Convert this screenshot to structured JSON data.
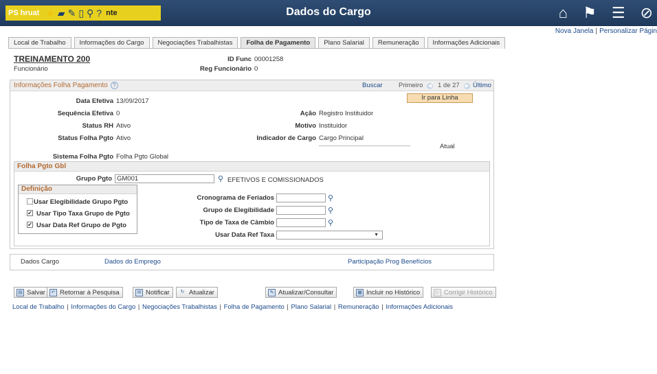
{
  "banner": {
    "ps_label": "PS hruat",
    "nte_label": "nte",
    "title": "Dados do Cargo",
    "left_icons": [
      "star-icon",
      "folder-icon",
      "pencil-icon",
      "document-icon",
      "search-icon",
      "help-icon"
    ],
    "right_icons": [
      "home-icon",
      "flag-icon",
      "menu-icon",
      "compass-icon"
    ]
  },
  "toplinks": {
    "new_window": "Nova Janela",
    "personalize": "Personalizar Págin"
  },
  "tabs": [
    {
      "label": "Local de Trabalho",
      "active": false
    },
    {
      "label": "Informações do Cargo",
      "active": false
    },
    {
      "label": "Negociações Trabalhistas",
      "active": false
    },
    {
      "label": "Folha de Pagamento",
      "active": true
    },
    {
      "label": "Plano Salarial",
      "active": false
    },
    {
      "label": "Remuneração",
      "active": false
    },
    {
      "label": "Informações Adicionais",
      "active": false
    }
  ],
  "employee": {
    "name": "TREINAMENTO 200",
    "type": "Funcionário",
    "id_func_label": "ID Func",
    "id_func_value": "00001258",
    "reg_label": "Reg Funcionário",
    "reg_value": "0"
  },
  "section": {
    "title": "Informações Folha Pagamento",
    "buscar": "Buscar",
    "primeiro": "Primeiro",
    "counter": "1 de 27",
    "ultimo": "Último",
    "goto_button": "Ir para Linha"
  },
  "fields": {
    "data_efetiva": {
      "label": "Data Efetiva",
      "value": "13/09/2017"
    },
    "sequencia": {
      "label": "Sequência Efetiva",
      "value": "0"
    },
    "status_rh": {
      "label": "Status RH",
      "value": "Ativo"
    },
    "status_folha": {
      "label": "Status Folha Pgto",
      "value": "Ativo"
    },
    "acao": {
      "label": "Ação",
      "value": "Registro Instituidor"
    },
    "motivo": {
      "label": "Motivo",
      "value": "Instituidor"
    },
    "indicador": {
      "label": "Indicador de Cargo",
      "value": "Cargo Principal"
    },
    "atual": "Atual",
    "sistema": {
      "label": "Sistema Folha Pgto",
      "value": "Folha Pgto Global"
    }
  },
  "gbl": {
    "title": "Folha Pgto Gbl",
    "grupo_label": "Grupo Pgto",
    "grupo_value": "GM001",
    "grupo_desc": "EFETIVOS E COMISSIONADOS",
    "definicao_title": "Definição",
    "checks": [
      {
        "label": "Usar Elegibilidade Grupo Pgto",
        "checked": false
      },
      {
        "label": "Usar Tipo Taxa Grupo de Pgto",
        "checked": true
      },
      {
        "label": "Usar Data Ref Grupo de Pgto",
        "checked": true
      }
    ],
    "cronograma_label": "Cronograma de Feriados",
    "grupo_eleg_label": "Grupo de Elegibilidade",
    "tipo_taxa_label": "Tipo de Taxa de Câmbio",
    "data_ref_label": "Usar Data Ref Taxa",
    "cronograma_value": "",
    "grupo_eleg_value": "",
    "tipo_taxa_value": "",
    "data_ref_value": ""
  },
  "links_box": {
    "dados_cargo": "Dados Cargo",
    "dados_emprego": "Dados do Emprego",
    "participacao": "Participação Prog Benefícios"
  },
  "toolbar": {
    "salvar": "Salvar",
    "retornar": "Retornar à Pesquisa",
    "notificar": "Notificar",
    "atualizar": "Atualizar",
    "atualizar_consultar": "Atualizar/Consultar",
    "incluir": "Incluir no Histórico",
    "corrigir": "Corrigir Histórico"
  },
  "bottom_links": [
    "Local de Trabalho",
    "Informações do Cargo",
    "Negociações Trabalhistas",
    "Folha de Pagamento",
    "Plano Salarial",
    "Remuneração",
    "Informações Adicionais"
  ],
  "colors": {
    "banner": "#203a5c",
    "banner_accent": "#e8d11e",
    "section_title": "#b26b33",
    "link": "#1c4a8b",
    "goto_button": "#f7dcb2"
  }
}
